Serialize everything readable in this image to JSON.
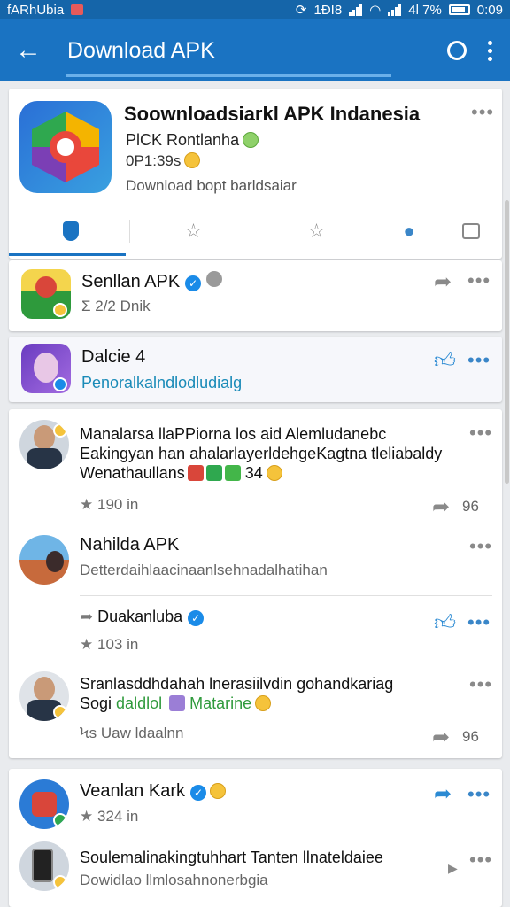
{
  "status_bar": {
    "carrier": "fARhUbia",
    "right_text": "1ĐI8",
    "battery": "4l 7%",
    "time": "0:09"
  },
  "app_bar": {
    "title": "Download APK",
    "back_icon": "arrow-left-icon",
    "search_icon": "ring-search-icon",
    "menu_icon": "kebab-menu-icon"
  },
  "header": {
    "title": "Soownloadsiarkl APK  Indanesia",
    "subtitle": "PlCK Rontlanha",
    "version": "0P1:39s",
    "description": "Download bopt barldsaiar",
    "more": "•••",
    "tabs": [
      {
        "icon": "shield-icon",
        "active": true
      },
      {
        "icon": "puzzle-icon",
        "active": false
      },
      {
        "icon": "star-outline-icon",
        "active": false
      },
      {
        "icon": "user-icon",
        "active": false
      },
      {
        "icon": "square-icon",
        "active": false
      }
    ]
  },
  "rows": {
    "senlian": {
      "name": "Senllan APK",
      "meta": "2/2 Dnik",
      "meta_prefix": "Σ",
      "more": "•••"
    },
    "dalcie": {
      "name": "Dalcie 4",
      "link": "Penoralkalndlodludialg",
      "more": "•••"
    }
  },
  "feed": {
    "post1": {
      "line1": "Manalarsa llaPPiorna los aid Alemludanebc",
      "line2": "Eakingyan han ahalarlayerldehgeKagtna tleliabaldy",
      "line3": "Wenathaullans",
      "line3_count": "34",
      "stat": "190 in",
      "count": "96",
      "more": "•••"
    },
    "post2": {
      "name": "Nahilda APK",
      "text": "Detterdaihlaacinaanlsehnadalhatihan",
      "more": "•••"
    },
    "post3": {
      "name": "Duakanluba",
      "stat": "103 in",
      "more": "•••"
    },
    "post4": {
      "line1": "Sranlasddhdahah lnerasiilvdin gohandkariag",
      "line2a": "Sogi",
      "line2b": "daldlol",
      "line2c": "Matarine",
      "meta": "Uaw ldaalnn",
      "meta_prefix": "Ϟs",
      "count": "96",
      "more": "•••"
    }
  },
  "bottom": {
    "vealan": {
      "name": "Veanlan Kark",
      "stat": "324 in",
      "more": "•••"
    },
    "last": {
      "title": "Soulemalinakingtuhhart Tanten llnateldaiee",
      "sub": "Dowidlao llmlosahnonerbgia",
      "more": "•••"
    }
  },
  "colors": {
    "primary": "#1a73c2",
    "status": "#1565a9",
    "link": "#1a8bb8",
    "accent_blue": "#2b8ad3"
  }
}
